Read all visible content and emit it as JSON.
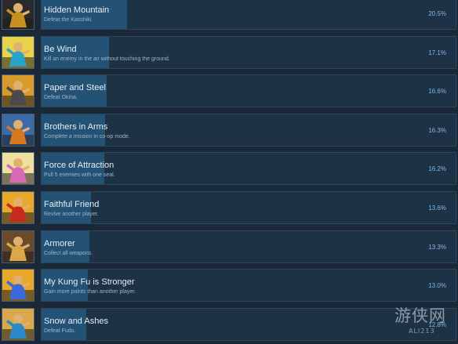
{
  "achievements": [
    {
      "title": "Hidden Mountain",
      "description": "Defeat the Kasshiki.",
      "percent_label": "20.5%",
      "percent": 20.5,
      "icon": "monk-portrait-icon",
      "icon_colors": [
        "#c8901e",
        "#2a2a2a"
      ]
    },
    {
      "title": "Be Wind",
      "description": "Kill an enemy in the air without touching the ground.",
      "percent_label": "17.1%",
      "percent": 17.1,
      "icon": "flying-kick-icon",
      "icon_colors": [
        "#2aa3c8",
        "#e8d24a"
      ]
    },
    {
      "title": "Paper and Steel",
      "description": "Defeat Okina.",
      "percent_label": "16.6%",
      "percent": 16.6,
      "icon": "monk-with-scroll-icon",
      "icon_colors": [
        "#4a4a4a",
        "#d89a2a"
      ]
    },
    {
      "title": "Brothers in Arms",
      "description": "Complete a mission in co-op mode.",
      "percent_label": "16.3%",
      "percent": 16.3,
      "icon": "two-monks-icon",
      "icon_colors": [
        "#d8781e",
        "#3a6aa8"
      ]
    },
    {
      "title": "Force of Attraction",
      "description": "Pull 5 enemies with one seal.",
      "percent_label": "16.2%",
      "percent": 16.2,
      "icon": "seal-pull-icon",
      "icon_colors": [
        "#d868b8",
        "#f0e0a0"
      ]
    },
    {
      "title": "Faithful Friend",
      "description": "Revive another player.",
      "percent_label": "13.6%",
      "percent": 13.6,
      "icon": "revive-icon",
      "icon_colors": [
        "#c82a1e",
        "#e8a82a"
      ]
    },
    {
      "title": "Armorer",
      "description": "Collect all weapons.",
      "percent_label": "13.3%",
      "percent": 13.3,
      "icon": "weapon-rack-icon",
      "icon_colors": [
        "#d8a84a",
        "#6a4a2a"
      ]
    },
    {
      "title": "My Kung Fu is Stronger",
      "description": "Gain more points than another player.",
      "percent_label": "13.0%",
      "percent": 13.0,
      "icon": "kung-fu-duel-icon",
      "icon_colors": [
        "#3a6ad8",
        "#e8a82a"
      ]
    },
    {
      "title": "Snow and Ashes",
      "description": "Defeat Fudo.",
      "percent_label": "12.8%",
      "percent": 12.8,
      "icon": "snow-monk-icon",
      "icon_colors": [
        "#2a8ac8",
        "#d8a84a"
      ]
    }
  ],
  "watermark": {
    "text_cn": "游侠网",
    "text_en": "ALI213"
  }
}
